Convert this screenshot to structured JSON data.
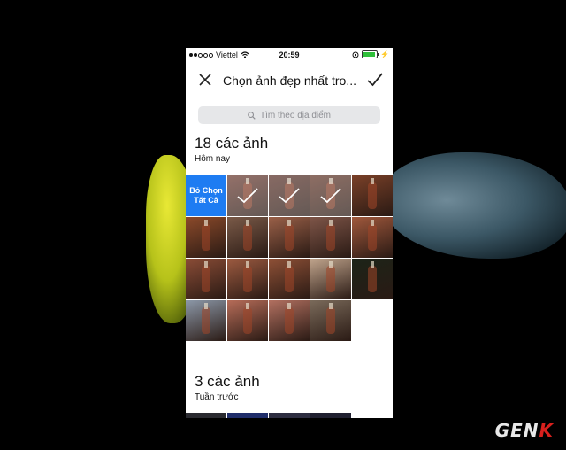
{
  "status_bar": {
    "carrier": "Viettel",
    "time": "20:59"
  },
  "navbar": {
    "title": "Chọn ảnh đẹp nhất tro..."
  },
  "search": {
    "placeholder": "Tìm theo địa điểm"
  },
  "sections": [
    {
      "count_label": "18 các ảnh",
      "date_label": "Hôm nay"
    },
    {
      "count_label": "3 các ảnh",
      "date_label": "Tuần trước"
    }
  ],
  "grid": {
    "deselect_line1": "Bỏ Chọn",
    "deselect_line2": "Tất Cả",
    "photos": [
      {
        "type": "deselect"
      },
      {
        "type": "photo",
        "bg": "#6b3a30",
        "selected": true
      },
      {
        "type": "photo",
        "bg": "#5a3128",
        "selected": true
      },
      {
        "type": "photo",
        "bg": "#623628",
        "selected": true
      },
      {
        "type": "photo",
        "bg": "#7a4028",
        "selected": false
      },
      {
        "type": "photo",
        "bg": "#8c4a2a",
        "selected": false
      },
      {
        "type": "photo",
        "bg": "#7a5a48",
        "selected": false
      },
      {
        "type": "photo",
        "bg": "#9a6048",
        "selected": false
      },
      {
        "type": "photo",
        "bg": "#7e5548",
        "selected": false
      },
      {
        "type": "photo",
        "bg": "#a0583c",
        "selected": false
      },
      {
        "type": "photo",
        "bg": "#8a4c36",
        "selected": false
      },
      {
        "type": "photo",
        "bg": "#9c5a40",
        "selected": false
      },
      {
        "type": "photo",
        "bg": "#8e5036",
        "selected": false
      },
      {
        "type": "photo",
        "bg": "#c0a48c",
        "selected": false
      },
      {
        "type": "photo",
        "bg": "#1c2418",
        "selected": false
      },
      {
        "type": "photo",
        "bg": "#8c98a8",
        "selected": false
      },
      {
        "type": "photo",
        "bg": "#b66c58",
        "selected": false
      },
      {
        "type": "photo",
        "bg": "#b27060",
        "selected": false
      },
      {
        "type": "photo",
        "bg": "#7a6a5a",
        "selected": false
      },
      {
        "type": "blank"
      }
    ]
  },
  "watermark": {
    "text_main": "GEN",
    "text_accent": "K"
  },
  "colors": {
    "accent": "#1e7cf2",
    "battery": "#2fbf3a"
  }
}
